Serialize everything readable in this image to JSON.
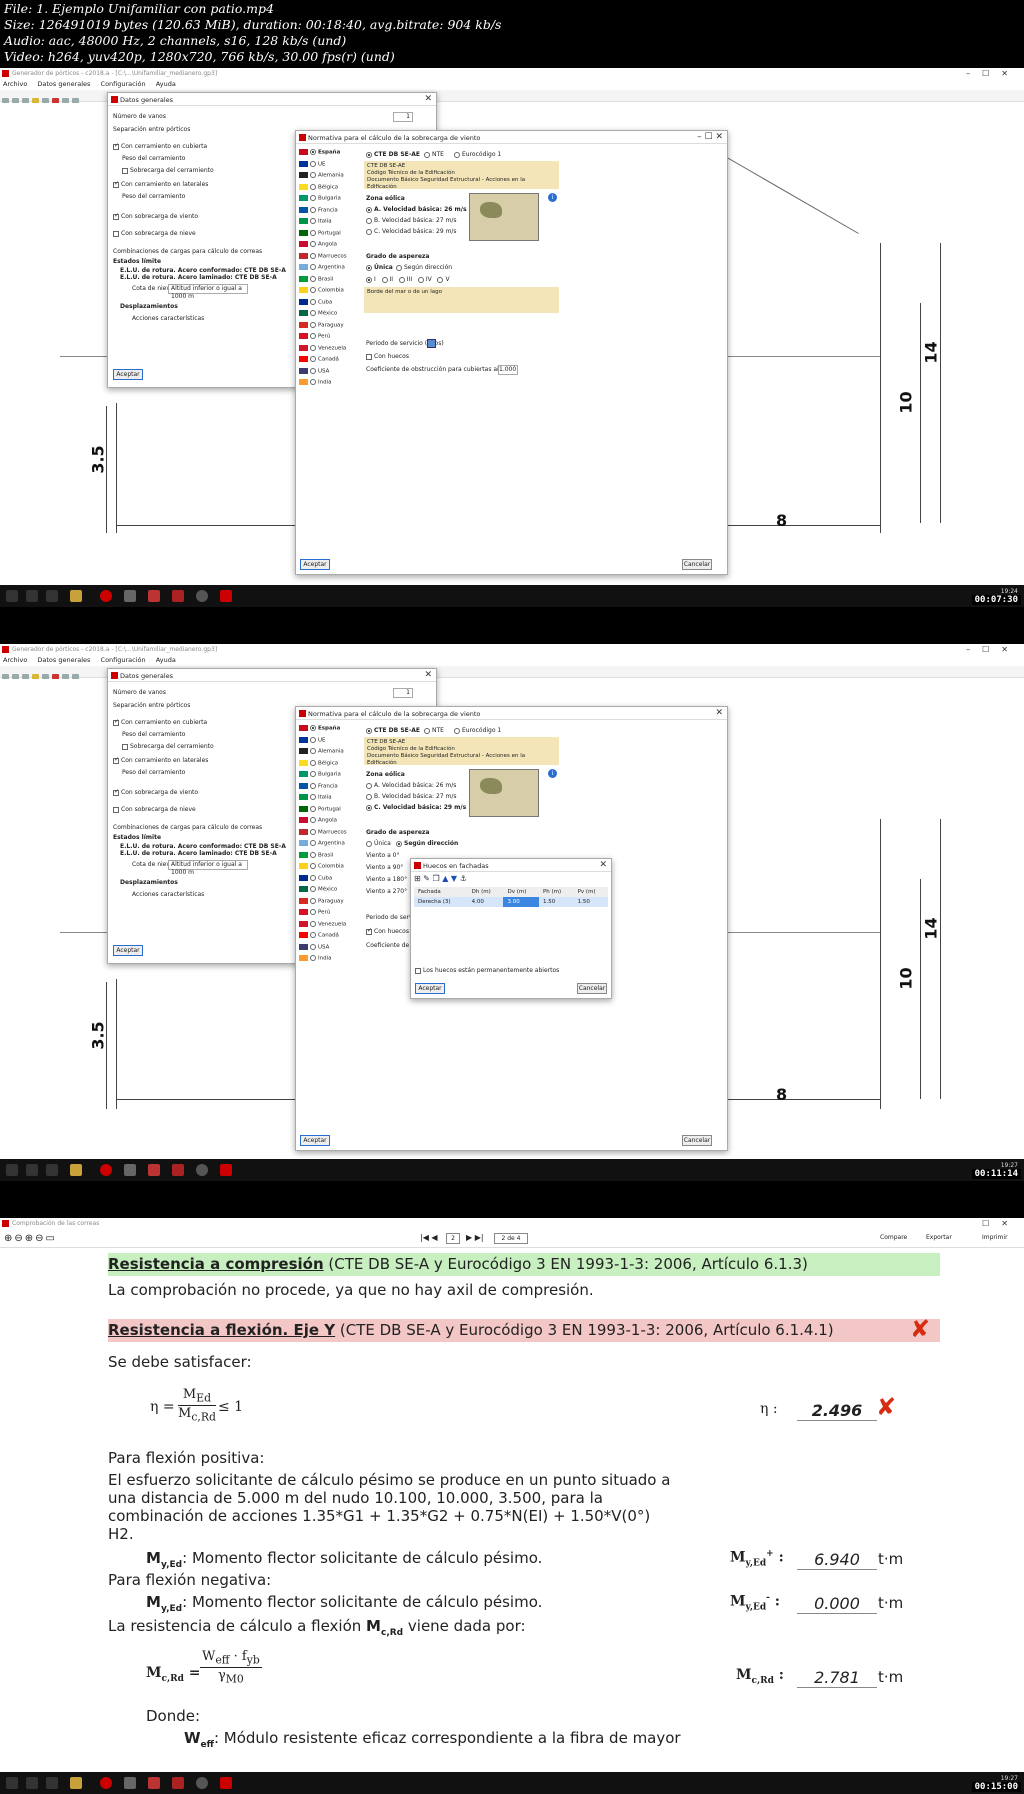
{
  "file_info": {
    "line1": "File: 1. Ejemplo Unifamiliar con patio.mp4",
    "line2": "Size: 126491019 bytes (120.63 MiB), duration: 00:18:40, avg.bitrate: 904 kb/s",
    "line3": "Audio: aac, 48000 Hz, 2 channels, s16, 128 kb/s (und)",
    "line4": "Video: h264, yuv420p, 1280x720, 766 kb/s, 30.00 fps(r) (und)"
  },
  "app": {
    "title": "Generador de pórticos - c2018.a - [C:\\...\\Unifamiliar_medianero.gp3]",
    "menu": [
      "Archivo",
      "Datos generales",
      "Configuración",
      "Ayuda"
    ]
  },
  "datos_generales": {
    "title": "Datos generales",
    "numero_vanos_label": "Número de vanos",
    "numero_vanos_value": "1",
    "separacion_label": "Separación entre pórticos",
    "cerramiento_cubierta": "Con cerramiento en cubierta",
    "peso_cerramiento": "Peso del cerramiento",
    "sobrecarga_cerramiento": "Sobrecarga del cerramiento",
    "cerramiento_laterales": "Con cerramiento en laterales",
    "peso_cerramiento2": "Peso del cerramiento",
    "sobrecarga_viento": "Con sobrecarga de viento",
    "sobrecarga_nieve": "Con sobrecarga de nieve",
    "combinaciones": "Combinaciones de cargas para cálculo de correas",
    "estados_limite": "Estados límite",
    "elu1": "E.L.U. de rotura. Acero conformado: CTE DB SE-A",
    "elu2": "E.L.U. de rotura. Acero laminado: CTE DB SE-A",
    "cota_nieve_label": "Cota de nieve",
    "cota_nieve_value": "Altitud inferior o igual a 1000 m",
    "desplazamientos": "Desplazamientos",
    "acciones": "Acciones características",
    "aceptar": "Aceptar"
  },
  "normativa": {
    "title": "Normativa para el cálculo de la sobrecarga de viento",
    "countries": [
      "España",
      "UE",
      "Alemania",
      "Bélgica",
      "Bulgaria",
      "Francia",
      "Italia",
      "Portugal",
      "Angola",
      "Marruecos",
      "Argentina",
      "Brasil",
      "Colombia",
      "Cuba",
      "México",
      "Paraguay",
      "Perú",
      "Venezuela",
      "Canadá",
      "USA",
      "India"
    ],
    "flag_colors": [
      "#c60b1e",
      "#003399",
      "#222222",
      "#fdda24",
      "#00966e",
      "#0055a4",
      "#009246",
      "#006600",
      "#cc092f",
      "#c1272d",
      "#74acdf",
      "#009c3b",
      "#fcd116",
      "#002a8f",
      "#006847",
      "#d52b1e",
      "#d91023",
      "#cf142b",
      "#ff0000",
      "#3c3b6e",
      "#ff9933"
    ],
    "std1": "CTE DB SE-AE",
    "std2": "NTE",
    "std3": "Eurocódigo 1",
    "desc1": "CTE DB SE-AE",
    "desc2": "Código Técnico de la Edificación",
    "desc3": "Documento Básico Seguridad Estructural - Acciones en la Edificación",
    "zona_eolica": "Zona eólica",
    "zonaA": "A. Velocidad básica: 26 m/s",
    "zonaB": "B. Velocidad básica: 27 m/s",
    "zonaC": "C. Velocidad básica: 29 m/s",
    "grado_aspereza": "Grado de aspereza",
    "unica": "Única",
    "segun_direccion": "Según dirección",
    "grados": [
      "I",
      "II",
      "III",
      "IV",
      "V"
    ],
    "borde": "Borde del mar o de un lago",
    "periodo": "Periodo de servicio (años)",
    "periodo_value": "50",
    "con_huecos": "Con huecos",
    "coeficiente": "Coeficiente de obstrucción para cubiertas aisladas",
    "coeficiente_value": "1.000",
    "viento_rows": [
      "Viento a 0°",
      "Viento a 90°",
      "Viento a 180°",
      "Viento a 270°"
    ],
    "aceptar": "Aceptar",
    "cancelar": "Cancelar"
  },
  "huecos": {
    "title": "Huecos en fachadas",
    "headers": [
      "Fachada",
      "Dh (m)",
      "Dv (m)",
      "Ph (m)",
      "Pv (m)"
    ],
    "row": [
      "Derecha (3)",
      "4.00",
      "3.00",
      "1.50",
      "1.50"
    ],
    "abiertos": "Los huecos están permanentemente abiertos",
    "aceptar": "Aceptar",
    "cancelar": "Cancelar"
  },
  "dims": {
    "d1": "3.5",
    "d2": "14",
    "d3": "10",
    "d4": "8"
  },
  "taskbar": {
    "time1": "19:24",
    "ts1": "00:07:30",
    "time2": "19:27",
    "ts2": "00:11:14",
    "time3": "19:27",
    "ts3": "00:15:00"
  },
  "report": {
    "window_title": "Comprobación de las correas",
    "page_value": "2",
    "page_total": "2 de 4",
    "compare": "Compare",
    "exportar": "Exportar",
    "imprimir": "Imprimir",
    "compresion_title": "Resistencia a compresión",
    "compresion_ref": " (CTE DB SE-A y Eurocódigo 3 EN 1993-1-3: 2006, Artículo 6.1.3)",
    "compresion_text": "La comprobación no procede, ya que no hay axil de compresión.",
    "flexion_title": "Resistencia a flexión. Eje Y",
    "flexion_ref": " (CTE DB SE-A y Eurocódigo 3 EN 1993-1-3: 2006, Artículo 6.1.4.1)",
    "satisfacer": "Se debe satisfacer:",
    "eta_lhs": "η =",
    "eta_num": "M",
    "eta_num_sub": "Ed",
    "eta_den": "M",
    "eta_den_sub": "c,Rd",
    "eta_rhs": "≤ 1",
    "eta_label": "η :",
    "eta_value": "2.496",
    "positiva": "Para flexión positiva:",
    "esfuerzo1": "El esfuerzo solicitante de cálculo pésimo se produce en un punto situado a",
    "esfuerzo2": "una distancia de 5.000 m del nudo 10.100, 10.000, 3.500, para la",
    "esfuerzo3": "combinación de acciones 1.35*G1 + 1.35*G2 + 0.75*N(EI) + 1.50*V(0°)",
    "esfuerzo4": "H2.",
    "myed_pos_def_sym": "M",
    "myed_pos_def_sub": "y,Ed",
    "myed_def": ": Momento flector solicitante de cálculo pésimo.",
    "myed_pos_label": "M",
    "myed_pos_sub": "y,Ed",
    "myed_pos_sup": "+",
    "myed_pos_value": "6.940",
    "negativa": "Para flexión negativa:",
    "myed_neg_def_sym": "M",
    "myed_neg_def_sub": "y,Ed",
    "myed_neg_label": "M",
    "myed_neg_sub": "y,Ed",
    "myed_neg_sup": "-",
    "myed_neg_value": "0.000",
    "resistencia_text1": "La resistencia de cálculo a flexión ",
    "resistencia_sym": "M",
    "resistencia_sub": "c,Rd",
    "resistencia_text2": " viene dada por:",
    "mcrd_lhs": "M",
    "mcrd_lhs_sub": "c,Rd",
    "mcrd_num": "W",
    "mcrd_num_sub": "eff",
    "mcrd_num2": " · f",
    "mcrd_num2_sub": "yb",
    "mcrd_den": "γ",
    "mcrd_den_sub": "M0",
    "mcrd_label": "M",
    "mcrd_label_sub": "c,Rd",
    "mcrd_value": "2.781",
    "unit": "t·m",
    "donde": "Donde:",
    "weff_sym": "W",
    "weff_sub": "eff",
    "weff_text": ": Módulo resistente eficaz correspondiente a la fibra de mayor"
  },
  "colors": {
    "green_band": "#c8efc0",
    "red_band": "#f4c7c7",
    "fail": "#d62d10"
  }
}
